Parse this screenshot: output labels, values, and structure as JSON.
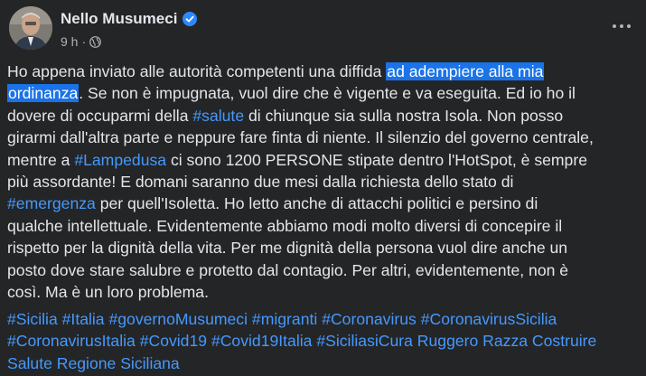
{
  "author": {
    "name": "Nello Musumeci",
    "time": "9 h",
    "separator": "·"
  },
  "colors": {
    "background": "#242526",
    "text": "#e4e6eb",
    "link": "#4599ff",
    "highlight": "#1a73e8",
    "verified": "#2d88ff"
  },
  "icons": {
    "verified": "verified-badge-icon",
    "audience": "globe-icon",
    "menu": "more-options-icon"
  },
  "body": {
    "l1a": "Ho appena inviato alle autorità competenti una diffida ",
    "l1hl": "ad adempiere alla mia",
    "l2hl": "ordinanza",
    "l2b": ". Se non è impugnata, vuol dire che è vigente e va eseguita. Ed io ho il",
    "l3a": "dovere di occuparmi della ",
    "l3tag": "#salute",
    "l3b": " di chiunque sia sulla nostra Isola. Non posso",
    "l4": "girarmi dall'altra parte e neppure fare finta di niente. Il silenzio del governo centrale,",
    "l5a": "mentre a ",
    "l5tag": "#Lampedusa",
    "l5b": " ci sono 1200 PERSONE stipate dentro l'HotSpot, è sempre",
    "l6": "più assordante! E domani saranno due mesi dalla richiesta dello stato di",
    "l7tag": "#emergenza",
    "l7b": " per quell'Isoletta. Ho letto anche di attacchi politici e persino di",
    "l8": "qualche intellettuale. Evidentemente abbiamo modi molto diversi di concepire il",
    "l9": "rispetto per la dignità della vita. Per me dignità della persona vuol dire anche un",
    "l10": "posto dove stare salubre e protetto dal contagio. Per altri, evidentemente, non è",
    "l11": "così. Ma è un loro problema."
  },
  "hashtags": {
    "line1": [
      "#Sicilia",
      "#Italia",
      "#governoMusumeci",
      "#migranti",
      "#Coronavirus",
      "#CoronavirusSicilia"
    ],
    "line2": [
      "#CoronavirusItalia",
      "#Covid19",
      "#Covid19Italia",
      "#SiciliasiCura"
    ],
    "line2_text": "Ruggero Razza Costruire",
    "line3_text": "Salute Regione Siciliana"
  }
}
